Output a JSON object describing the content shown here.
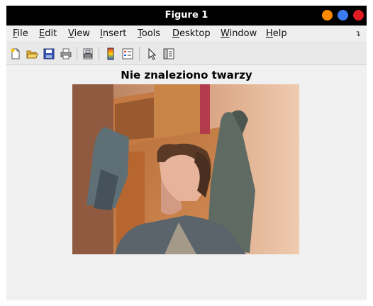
{
  "window": {
    "title": "Figure 1",
    "controls": [
      {
        "name": "minimize",
        "color": "#ff8a00"
      },
      {
        "name": "maximize",
        "color": "#3b7cf0"
      },
      {
        "name": "close",
        "color": "#e01b24"
      }
    ]
  },
  "menubar": {
    "items": [
      {
        "accel": "F",
        "rest": "ile"
      },
      {
        "accel": "E",
        "rest": "dit"
      },
      {
        "accel": "V",
        "rest": "iew"
      },
      {
        "accel": "I",
        "rest": "nsert"
      },
      {
        "accel": "T",
        "rest": "ools"
      },
      {
        "accel": "D",
        "rest": "esktop"
      },
      {
        "accel": "W",
        "rest": "indow"
      },
      {
        "accel": "H",
        "rest": "elp"
      }
    ],
    "overflow_icon": "curved-arrow-icon"
  },
  "toolbar": {
    "icons": [
      "new-figure-icon",
      "open-file-icon",
      "save-icon",
      "print-icon",
      "print-preview-icon",
      "colorbar-icon",
      "legend-icon",
      "select-arrow-icon",
      "property-editor-icon"
    ]
  },
  "figure": {
    "title": "Nie znaleziono twarzy",
    "image_content": "webcam photo of a person with curly hair in a grey t-shirt, seen in profile, in a room with a wooden wardrobe and hanging jackets"
  }
}
